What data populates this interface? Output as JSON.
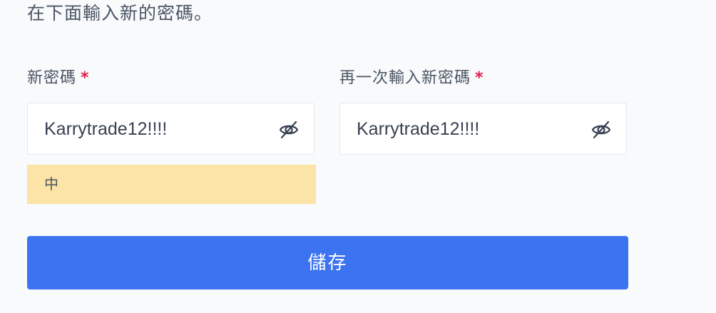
{
  "instruction": "在下面輸入新的密碼。",
  "new_password": {
    "label": "新密碼",
    "required_mark": "*",
    "value": "Karrytrade12!!!!",
    "toggle_icon": "eye-slash-icon"
  },
  "confirm_password": {
    "label": "再一次輸入新密碼",
    "required_mark": "*",
    "value": "Karrytrade12!!!!",
    "toggle_icon": "eye-slash-icon"
  },
  "strength": {
    "label": "中",
    "color": "#fce4a6"
  },
  "save_button": {
    "label": "儲存",
    "color": "#3b73f0"
  },
  "colors": {
    "required": "#e11d48",
    "background": "#f8fafc"
  }
}
